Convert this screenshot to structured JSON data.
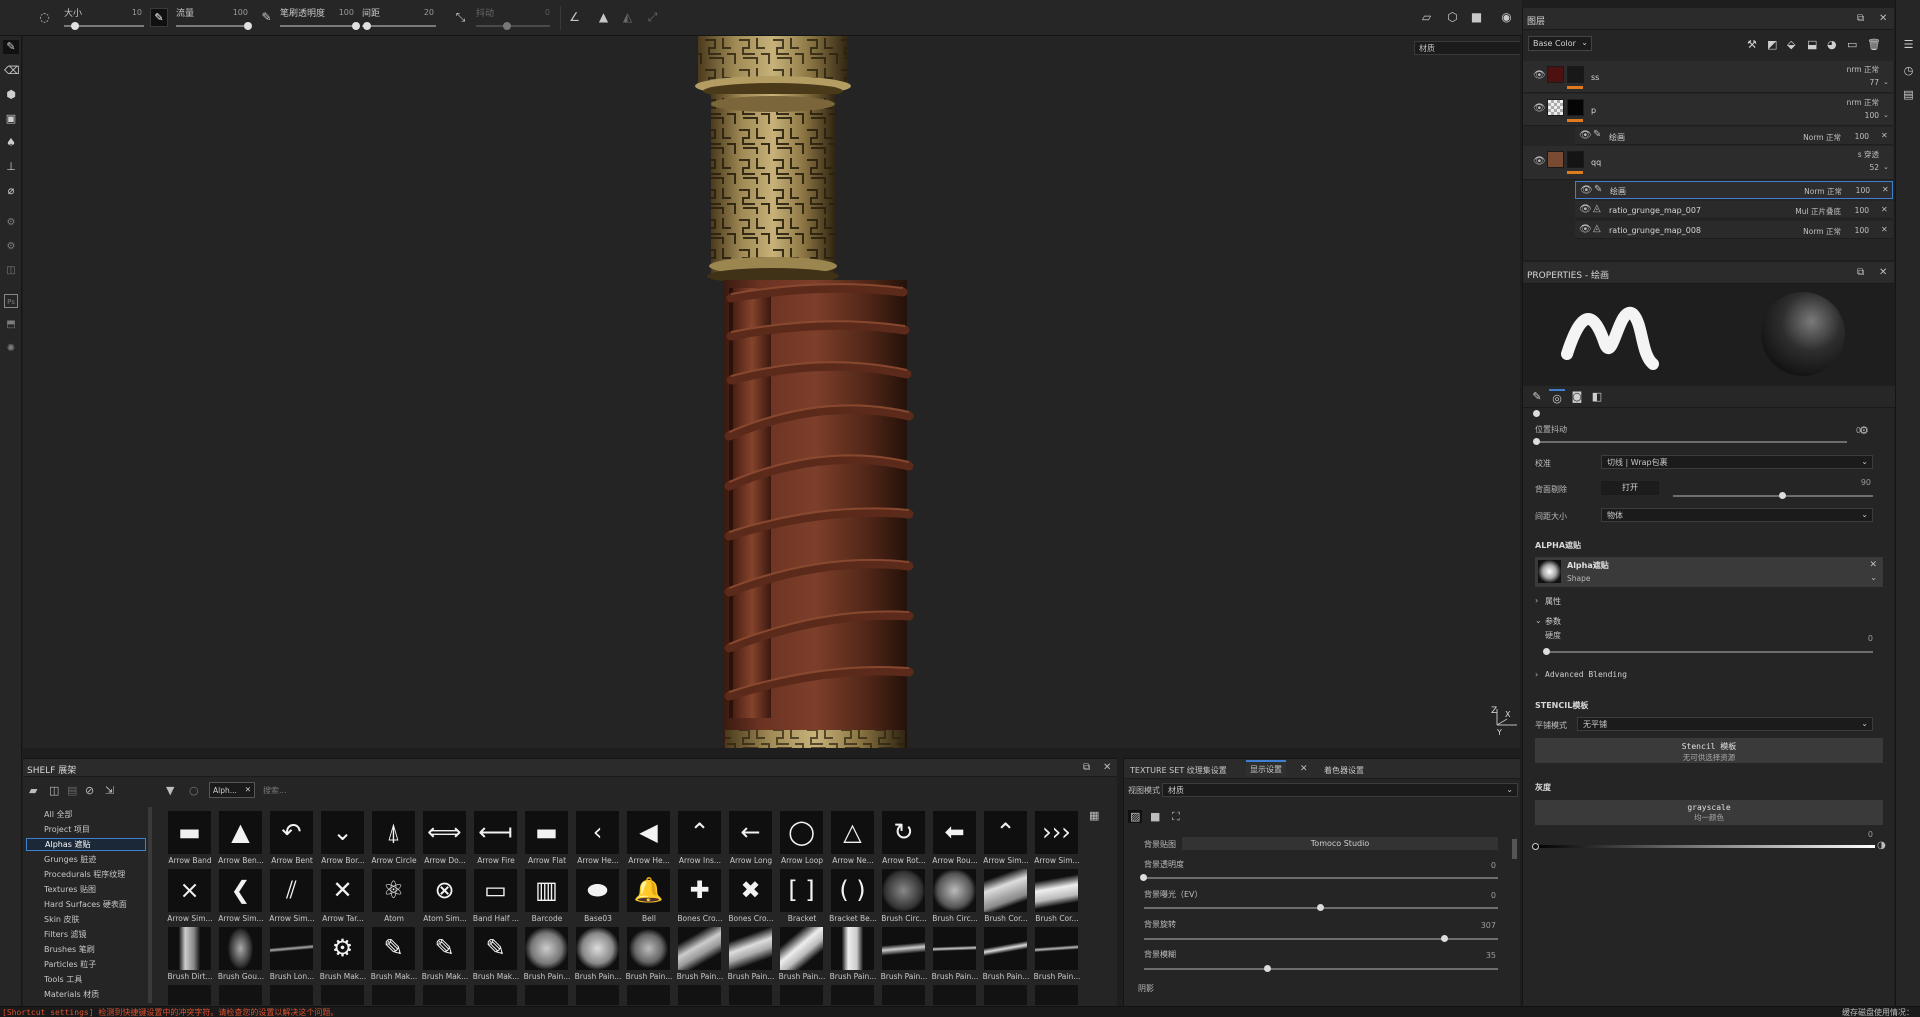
{
  "toolbar": {
    "size_label": "大小",
    "size_value": "10",
    "flow_label": "流量",
    "flow_value": "100",
    "stroke_opacity_label": "笔刷透明度",
    "stroke_opacity_value": "100",
    "spacing_label": "间距",
    "spacing_value": "20",
    "jitter_label": "抖动",
    "jitter_value": "0",
    "brush_size_level": 0.14,
    "flow_level": 1.0,
    "stroke_opacity_level": 1.0,
    "spacing_level": 0.07
  },
  "viewport": {
    "mode_dropdown": "材质",
    "axis_z": "Z",
    "axis_x": "X",
    "axis_y": "Y"
  },
  "layers": {
    "title": "图层",
    "channel_dropdown": "Base Color",
    "items": [
      {
        "name": "ss",
        "blend": "nrm 正常",
        "opacity": "77"
      },
      {
        "name": "p",
        "blend": "nrm 正常",
        "opacity": "100"
      },
      {
        "name": "绘画",
        "blend": "Norm 正常",
        "opacity": "100"
      },
      {
        "name": "qq",
        "blend": "s 穿透",
        "opacity": "52"
      },
      {
        "name": "绘画",
        "blend": "Norm 正常",
        "opacity": "100"
      },
      {
        "name": "ratio_grunge_map_007",
        "blend": "Mul 正片叠底",
        "opacity": "100"
      },
      {
        "name": "ratio_grunge_map_008",
        "blend": "Norm 正常",
        "opacity": "100"
      }
    ]
  },
  "properties": {
    "title": "PROPERTIES - 绘画",
    "position_jitter_label": "位置抖动",
    "position_jitter_value": "0",
    "alignment_label": "校准",
    "alignment_value": "切线 | Wrap包裹",
    "backface_label": "背面剔除",
    "backface_button": "打开",
    "backface_value": "90",
    "spacing_size_label": "间距大小",
    "spacing_size_value": "物体",
    "alpha_section": "ALPHA遮贴",
    "alpha_name": "Alpha遮贴",
    "alpha_type": "Shape",
    "attributes_label": "属性",
    "params_label": "参数",
    "hardness_label": "硬度",
    "hardness_value": "0",
    "advanced_blending": "Advanced Blending",
    "stencil_section": "STENCIL模板",
    "tiling_label": "平铺模式",
    "tiling_value": "无平铺",
    "stencil_button": "Stencil 模板",
    "stencil_sub": "无可供选择资源",
    "gray_section": "灰度",
    "gray_button": "grayscale",
    "gray_sub": "均一颜色",
    "gray_value": "0",
    "backface_level": 0.55
  },
  "shelf": {
    "title": "SHELF 展架",
    "filter_chip": "Alph...",
    "search_placeholder": "搜索...",
    "tree": [
      "All 全部",
      "Project 项目",
      "Alphas 遮贴",
      "Grunges 脏迹",
      "Procedurals 程序纹理",
      "Textures 贴图",
      "Hard Surfaces 硬表面",
      "Skin 皮肤",
      "Filters 滤镜",
      "Brushes 笔刷",
      "Particles 粒子",
      "Tools 工具",
      "Materials 材质"
    ],
    "tiles_row1": [
      "Arrow Band",
      "Arrow Ben...",
      "Arrow Bent",
      "Arrow Bor...",
      "Arrow Circle",
      "Arrow Do...",
      "Arrow Fire",
      "Arrow Flat",
      "Arrow He...",
      "Arrow He...",
      "Arrow Ins...",
      "Arrow Long",
      "Arrow Loop",
      "Arrow Ne...",
      "Arrow Rot...",
      "Arrow Rou...",
      "Arrow Sim...",
      "Arrow Sim..."
    ],
    "tiles_row2": [
      "Arrow Sim...",
      "Arrow Sim...",
      "Arrow Sim...",
      "Arrow Tar...",
      "Atom",
      "Atom Sim...",
      "Band Half ...",
      "Barcode",
      "Base03",
      "Bell",
      "Bones Cro...",
      "Bones Cro...",
      "Bracket",
      "Bracket Be...",
      "Brush Circ...",
      "Brush Circ...",
      "Brush Cor...",
      "Brush Cor..."
    ],
    "tiles_row3": [
      "Brush Dirt...",
      "Brush Gou...",
      "Brush Lon...",
      "Brush Mak...",
      "Brush Mak...",
      "Brush Mak...",
      "Brush Mak...",
      "Brush Pain...",
      "Brush Pain...",
      "Brush Pain...",
      "Brush Pain...",
      "Brush Pain...",
      "Brush Pain...",
      "Brush Pain...",
      "Brush Pain...",
      "Brush Pain...",
      "Brush Pain...",
      "Brush Pain..."
    ]
  },
  "display": {
    "tab1": "TEXTURE SET 纹理集设置",
    "tab2": "显示设置",
    "tab3": "着色器设置",
    "view_mode_label": "视图模式",
    "view_mode_value": "材质",
    "env_map_label": "背景贴图",
    "env_map_value": "Tomoco Studio",
    "env_opacity_label": "背景透明度",
    "env_opacity_value": "0",
    "env_exposure_label": "背景曝光（EV）",
    "env_exposure_value": "0",
    "env_rotation_label": "背景旋转",
    "env_rotation_value": "307",
    "env_blur_label": "背景模糊",
    "env_blur_value": "35",
    "shadow_label": "阴影",
    "env_opacity_level": 0.0,
    "env_exposure_level": 0.5,
    "env_rotation_level": 0.85,
    "env_blur_level": 0.35
  },
  "status": {
    "message": "[Shortcut settings] 检测到快捷键设置中的冲突字符。请检查您的设置以解决这个问题。",
    "right": "缓存磁盘使用情况："
  }
}
